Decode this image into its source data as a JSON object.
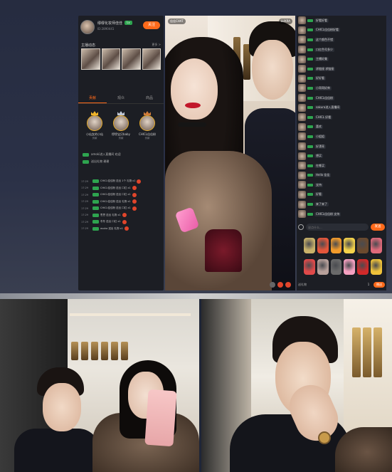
{
  "left_panel": {
    "host": {
      "name": "缪缪化妆师佳佳",
      "badge": "Lv",
      "sub": "ID:2890441",
      "follow_label": "关注"
    },
    "section": {
      "title": "主播动态",
      "more": "更多 >"
    },
    "tabs": [
      {
        "label": "贡献",
        "active": true
      },
      {
        "label": "观众"
      },
      {
        "label": "商品"
      }
    ],
    "ranks": [
      {
        "name": "小仙女的小仙",
        "sub": "贡献",
        "crown": "gold"
      },
      {
        "name": "缪缪宝贝baby",
        "sub": "贡献",
        "crown": "silver"
      },
      {
        "name": "CHICL佳佳粉",
        "sub": "贡献",
        "crown": "bronze"
      }
    ],
    "info": [
      {
        "text": "amoki进入直播间 欢迎"
      },
      {
        "text": "送出礼物 谢谢"
      }
    ],
    "feed": [
      {
        "time": "17:29",
        "text": "CHICL佳佳粉 送出 1个 礼物 x1"
      },
      {
        "time": "17:29",
        "text": "CHICL佳佳粉 送出 口红 x1"
      },
      {
        "time": "17:29",
        "text": "CHICL佳佳粉 送出 口红 x1"
      },
      {
        "time": "17:29",
        "text": "CHICL佳佳粉 送出 礼物 x1"
      },
      {
        "time": "17:29",
        "text": "CHICL佳佳粉 送出 口红 x1"
      },
      {
        "time": "17:29",
        "text": "思思 送出 礼物 x1"
      },
      {
        "time": "17:29",
        "text": "冬冬 送出 口红 x1"
      },
      {
        "time": "17:29",
        "text": "asuka 送出 礼物 x1"
      }
    ]
  },
  "video": {
    "tag_left": "佳佳CHAT",
    "tag_right": "LUXRA"
  },
  "chat": {
    "messages": [
      {
        "text": "好看好看"
      },
      {
        "text": "CHICL佳佳粉好看"
      },
      {
        "text": "这个颜色不错"
      },
      {
        "text": "口红色号多少"
      },
      {
        "text": "主播好美"
      },
      {
        "text": "求链接 求链接"
      },
      {
        "text": "好好看"
      },
      {
        "text": "小哥哥好帅"
      },
      {
        "text": "CHICL佳佳粉"
      },
      {
        "text": "sakura进入直播间"
      },
      {
        "text": "CHICL 好看"
      },
      {
        "text": "喜欢"
      },
      {
        "text": "小姐姐"
      },
      {
        "text": "好漂亮"
      },
      {
        "text": "想买"
      },
      {
        "text": "在哪买"
      },
      {
        "text": "Hello 佳佳"
      },
      {
        "text": "支持"
      },
      {
        "text": "好看"
      },
      {
        "text": "来了来了"
      },
      {
        "text": "CHICL佳佳粉 支持"
      }
    ],
    "input_placeholder": "说点什么...",
    "send_label": "发送",
    "gift_footer_text": "送礼物",
    "gift_qty": "1",
    "gift_send_label": "赠送",
    "gift_colors": [
      "#c9b26a",
      "#e4563b",
      "#f29b2b",
      "#f4d24a",
      "#6b4a2e",
      "#e06a7a",
      "#e04a4a",
      "#b7a09a",
      "#6a6a6a",
      "#f5a0c0",
      "#d12a2a",
      "#efc23a"
    ]
  }
}
